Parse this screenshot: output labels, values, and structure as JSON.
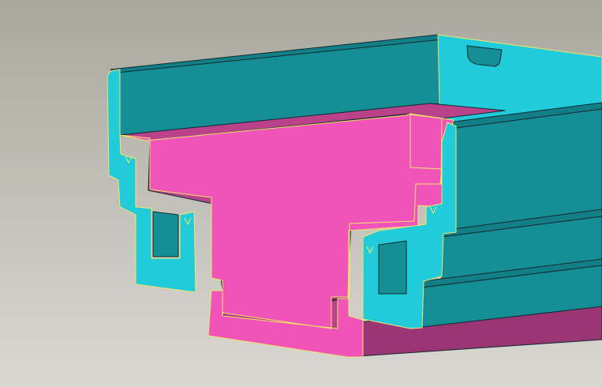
{
  "scene": {
    "kind": "cad-3d-section-view",
    "subject": "stepped-channel-extrusion-section",
    "colors": {
      "background_top": "#A9A89F",
      "background_bottom": "#D9D8D1",
      "teal_face": "#158E96",
      "teal_face_dark": "#127F86",
      "cyan_section": "#22CBD9",
      "magenta_face": "#9A3573",
      "magenta_face_light": "#B9428A",
      "pink_section": "#F154B9",
      "edge_line": "#0E2A2E",
      "section_outline": "#F3E66A"
    }
  }
}
